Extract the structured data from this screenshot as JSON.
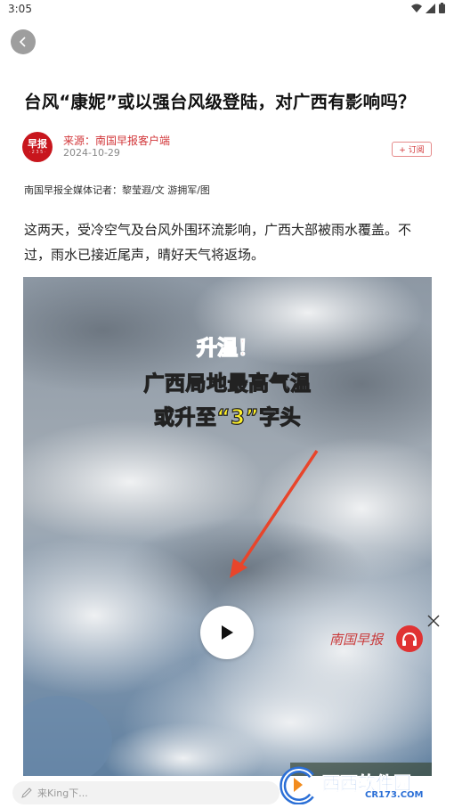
{
  "status_bar": {
    "time": "3:05"
  },
  "article": {
    "title": "台风“康妮”或以强台风级登陆，对广西有影响吗？",
    "logo_text": "早报",
    "logo_sub": "· 2 3 5 ·",
    "source": "来源：南国早报客户端",
    "date": "2024-10-29",
    "subscribe_label": "+ 订阅",
    "byline": "南国早报全媒体记者：黎莹遐/文 游拥军/图",
    "paragraph": "这两天，受冷空气及台风外围环流影响，广西大部被雨水覆盖。不过，雨水已接近尾声，晴好天气将返场。"
  },
  "video": {
    "overlay_line1": "升温！",
    "overlay_line2": "广西局地最高气温",
    "overlay_line3": "或升至“3”字头",
    "watermark": "南国早报"
  },
  "bottom_bar": {
    "comment_placeholder": "来King下..."
  },
  "brand_watermark": {
    "name": "西西软件园",
    "url": "CR173.COM"
  },
  "colors": {
    "accent_red": "#d2373a",
    "overlay_yellow": "#fff12a",
    "overlay_red": "#e8201e"
  },
  "icons": [
    "back-arrow-icon",
    "wifi-icon",
    "signal-icon",
    "battery-icon",
    "play-icon",
    "close-icon",
    "pen-icon",
    "headphones-icon"
  ]
}
